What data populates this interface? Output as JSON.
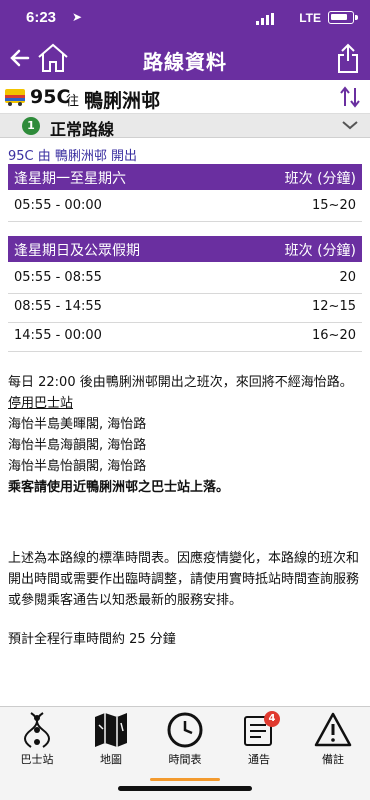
{
  "status": {
    "time": "6:23",
    "network": "LTE"
  },
  "header": {
    "title": "路線資料"
  },
  "route": {
    "number": "95C",
    "direction": "往",
    "destination": "鴨脷洲邨"
  },
  "variant": {
    "index": "1",
    "label": "正常路線"
  },
  "origin": "95C 由 鴨脷洲邨 開出",
  "schedules": [
    {
      "title": "逢星期一至星期六",
      "freq_header": "班次 (分鐘)",
      "rows": [
        {
          "time": "05:55 - 00:00",
          "freq": "15~20"
        }
      ]
    },
    {
      "title": "逢星期日及公眾假期",
      "freq_header": "班次 (分鐘)",
      "rows": [
        {
          "time": "05:55 - 08:55",
          "freq": "20"
        },
        {
          "time": "08:55 - 14:55",
          "freq": "12~15"
        },
        {
          "time": "14:55 - 00:00",
          "freq": "16~20"
        }
      ]
    }
  ],
  "notes": {
    "line1": "每日 22:00 後由鴨脷洲邨開出之班次，來回將不經海怡路。",
    "suspended_title": "停用巴士站",
    "stops": [
      "海怡半島美暉閣, 海怡路",
      "海怡半島海韻閣, 海怡路",
      "海怡半島怡韻閣, 海怡路"
    ],
    "bold_note": "乘客請使用近鴨脷洲邨之巴士站上落。",
    "para2": "上述為本路線的標準時間表。因應疫情變化，本路線的班次和開出時間或需要作出臨時調整，請使用實時抵站時間查詢服務或參閱乘客通告以知悉最新的服務安排。",
    "journey": "預計全程行車時間約 25 分鐘"
  },
  "bottom_nav": {
    "items": [
      {
        "label": "巴士站",
        "icon": "bus-stops-icon"
      },
      {
        "label": "地圖",
        "icon": "map-icon"
      },
      {
        "label": "時間表",
        "icon": "clock-icon"
      },
      {
        "label": "通告",
        "icon": "notice-icon",
        "badge": "4"
      },
      {
        "label": "備註",
        "icon": "warning-icon"
      }
    ]
  },
  "colors": {
    "primary": "#6a2fa0",
    "accent": "#f39a2e",
    "badge": "#e03a2f",
    "green": "#2e8b3a"
  }
}
